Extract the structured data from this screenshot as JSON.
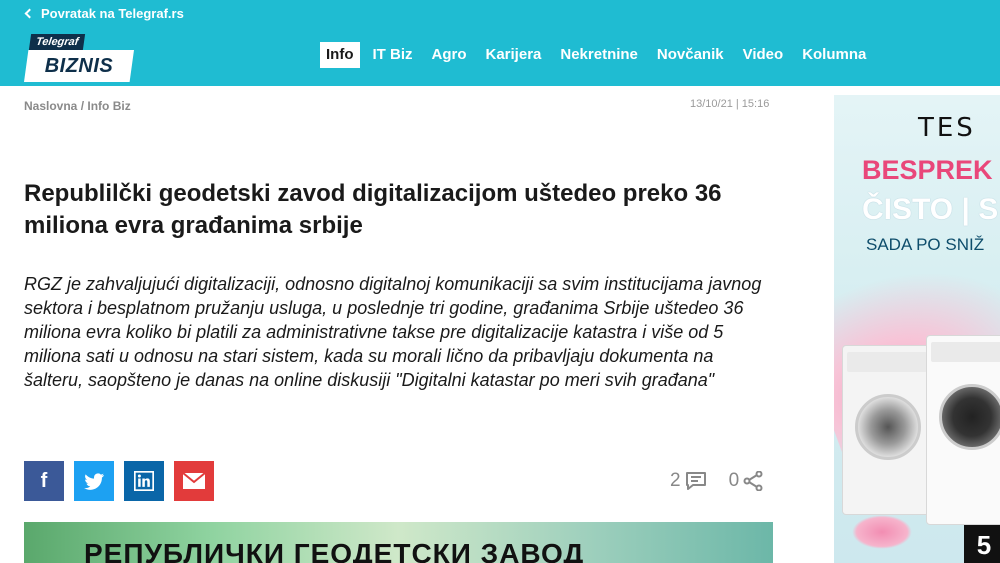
{
  "topbar": {
    "back_label": "Povratak na Telegraf.rs"
  },
  "logo": {
    "top": "Telegraf",
    "bottom": "BIZNIS"
  },
  "nav": {
    "items": [
      {
        "label": "Info"
      },
      {
        "label": "IT Biz"
      },
      {
        "label": "Agro"
      },
      {
        "label": "Karijera"
      },
      {
        "label": "Nekretnine"
      },
      {
        "label": "Novčanik"
      },
      {
        "label": "Video"
      },
      {
        "label": "Kolumna"
      }
    ],
    "active": "Info"
  },
  "breadcrumb": {
    "home": "Naslovna",
    "separator": " / ",
    "section": "Info Biz"
  },
  "article": {
    "timestamp": "13/10/21 | 15:16",
    "title": "Republilčki geodetski zavod digitalizacijom uštedeo preko 36 miliona evra građanima srbije",
    "lead": "RGZ je zahvaljujući digitalizaciji, odnosno digitalnoj komunikaciji sa svim institucijama javnog sektora i besplatnom pružanju usluga, u poslednje tri godine, građanima Srbije uštedeo 36 miliona evra koliko bi platili za administrativne takse pre digitalizacije katastra i više od 5 miliona sati u odnosu na stari sistem, kada su morali lično da pribavljaju dokumenta na šalteru, saopšteno je danas na online diskusiji \"Digitalni katastar po meri svih građana\"",
    "comments_count": "2",
    "shares_count": "0",
    "image_caption_text": "РЕПУБЛИЧКИ ГЕОДЕТСКИ ЗАВОД"
  },
  "share": {
    "facebook": "f",
    "twitter": "twitter-icon",
    "linkedin": "linkedin-icon",
    "email": "email-icon"
  },
  "ad": {
    "brand": "TES",
    "line1": "BESPREK",
    "line2": "ČISTO | S",
    "line3": "SADA PO SNIŽ",
    "badge": "5"
  },
  "colors": {
    "brand_cyan": "#1fbcd2",
    "logo_navy": "#0e2f4a",
    "facebook": "#3b5998",
    "twitter": "#1da1f2",
    "linkedin": "#0a66a8",
    "email": "#e23b3b",
    "ad_pink": "#e9477a"
  }
}
